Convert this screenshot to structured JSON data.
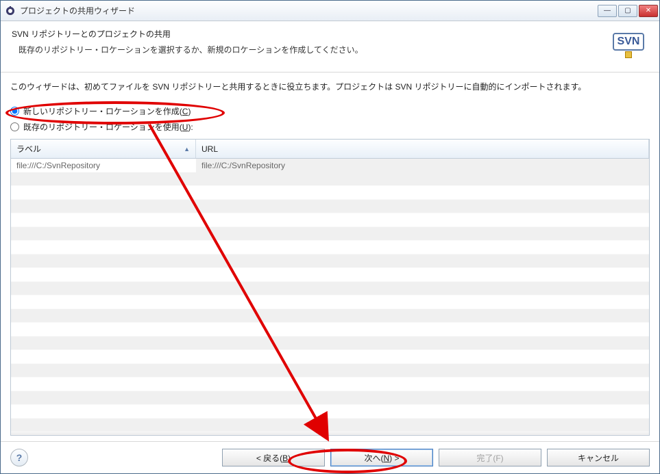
{
  "titlebar": {
    "title": "プロジェクトの共用ウィザード"
  },
  "banner": {
    "title": "SVN リポジトリーとのプロジェクトの共用",
    "subtitle": "既存のリポジトリー・ロケーションを選択するか、新規のロケーションを作成してください。",
    "logo_text": "SVN"
  },
  "content": {
    "intro": "このウィザードは、初めてファイルを SVN リポジトリーと共用するときに役立ちます。プロジェクトは SVN リポジトリーに自動的にインポートされます。",
    "radio_create_prefix": "新しいリポジトリー・ロケーションを作成(",
    "radio_create_mnemonic": "C",
    "radio_create_suffix": ")",
    "radio_use_prefix": "既存のリポジトリー・ロケーションを使用(",
    "radio_use_mnemonic": "U",
    "radio_use_suffix": "):",
    "table": {
      "col_label": "ラベル",
      "col_url": "URL",
      "rows": [
        {
          "label": "file:///C:/SvnRepository",
          "url": "file:///C:/SvnRepository"
        }
      ]
    }
  },
  "footer": {
    "back_prefix": "< 戻る(",
    "back_mnemonic": "B",
    "back_suffix": ")",
    "next_prefix": "次へ(",
    "next_mnemonic": "N",
    "next_suffix": ") >",
    "finish_prefix": "完了(",
    "finish_mnemonic": "F",
    "finish_suffix": ")",
    "cancel": "キャンセル"
  }
}
